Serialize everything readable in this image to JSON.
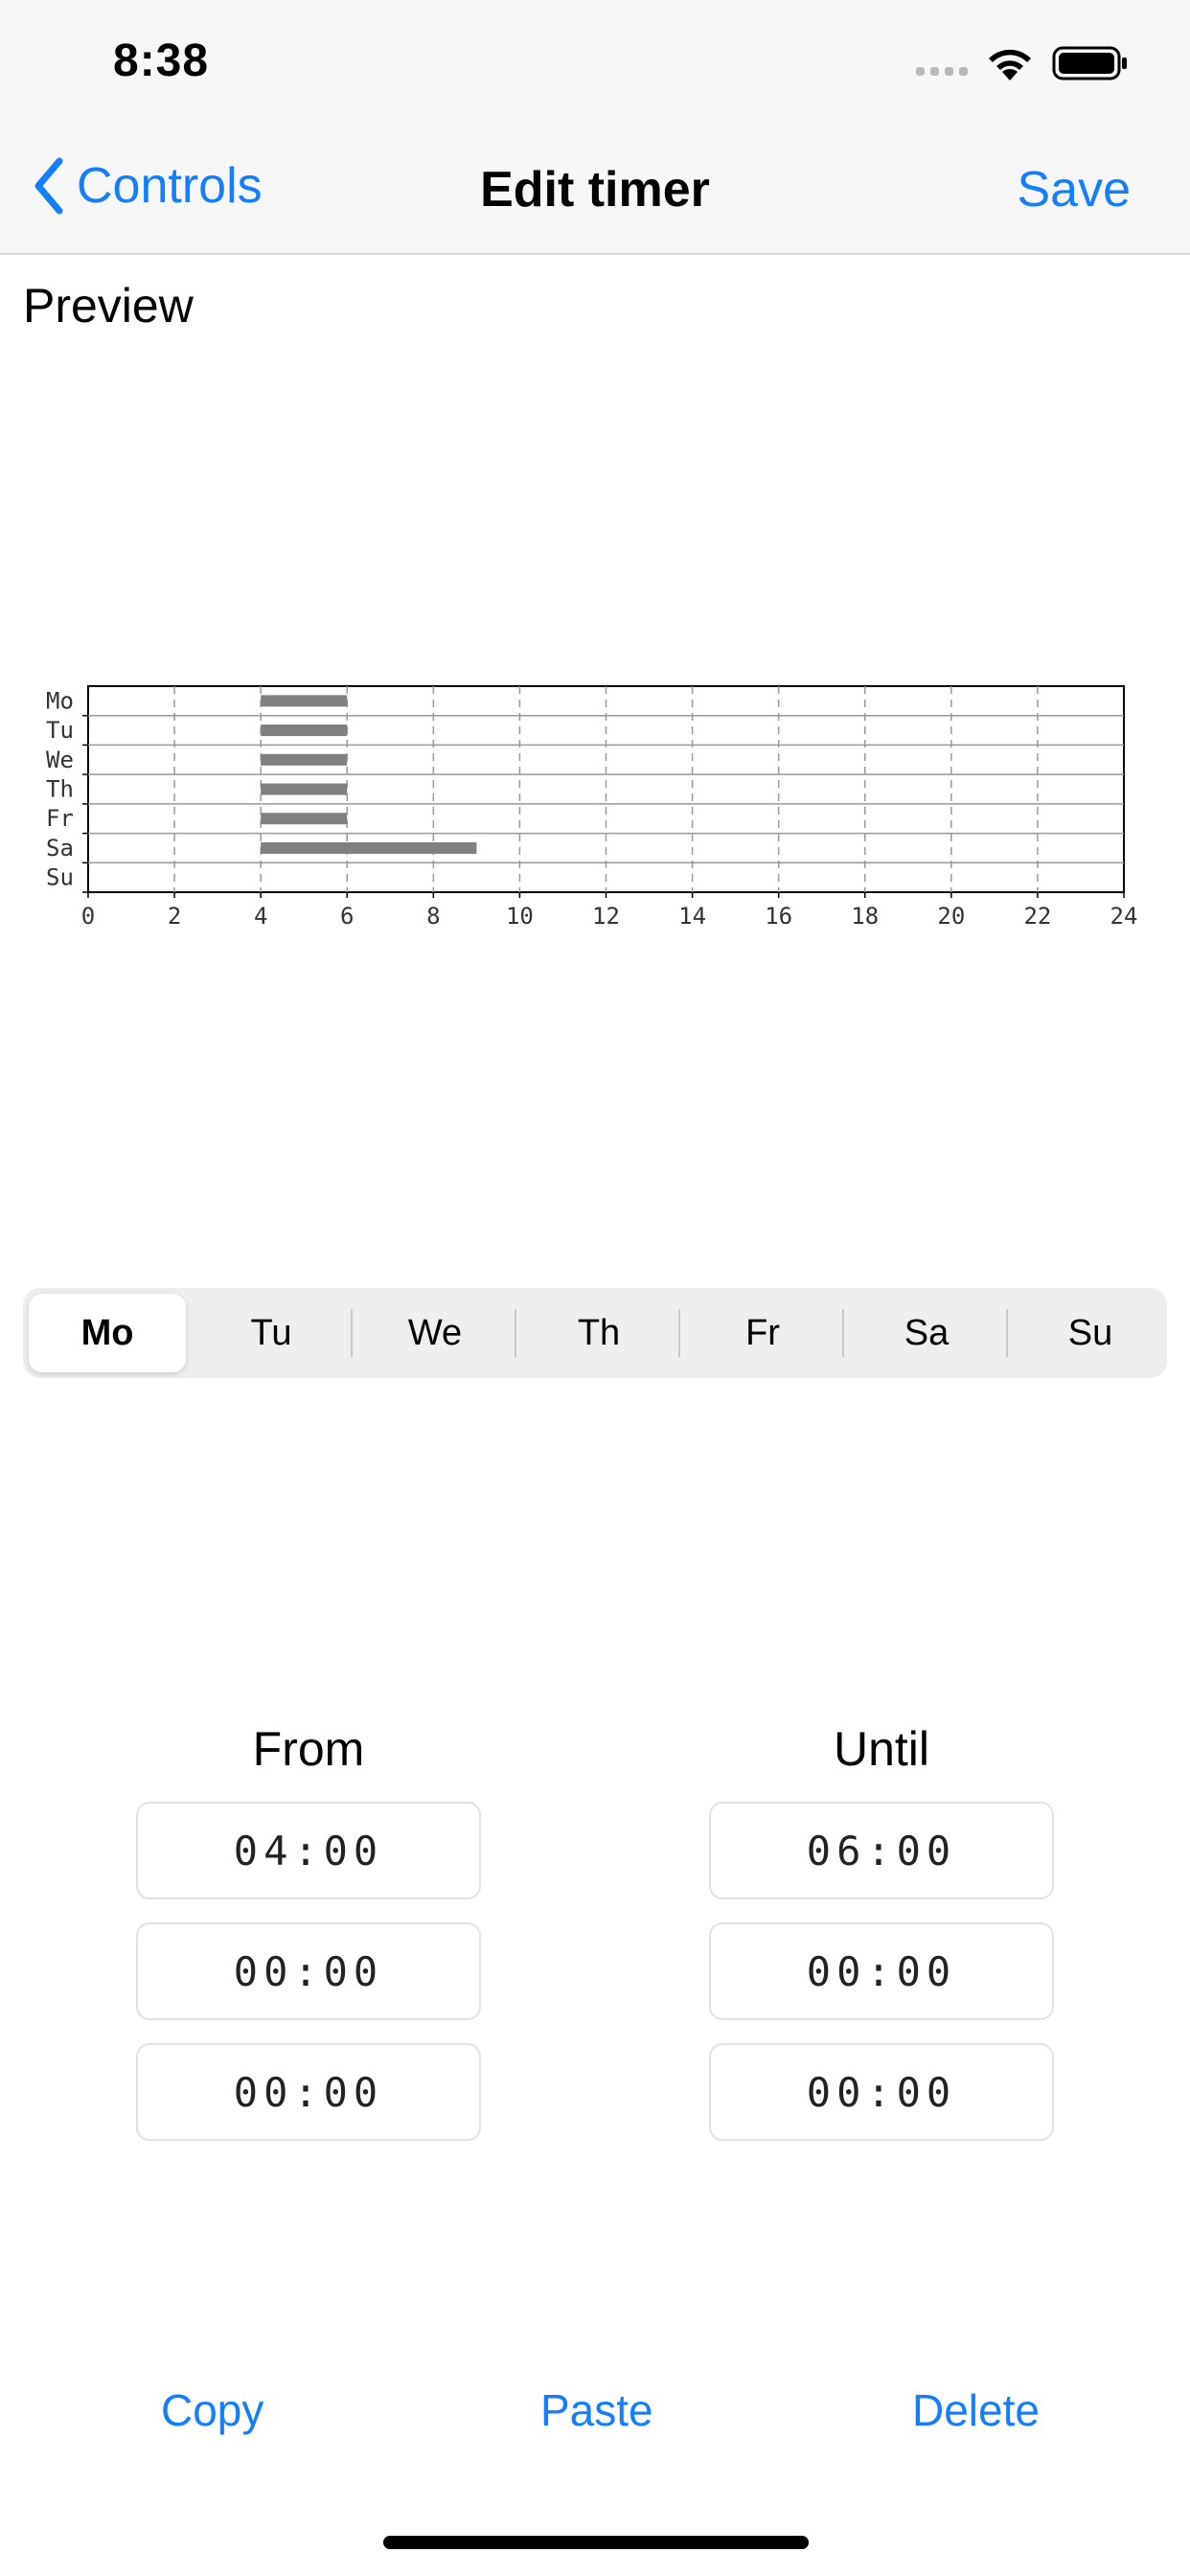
{
  "status": {
    "time": "8:38"
  },
  "nav": {
    "back_label": "Controls",
    "title": "Edit timer",
    "save_label": "Save"
  },
  "preview": {
    "label": "Preview"
  },
  "chart_data": {
    "type": "bar",
    "orientation": "horizontal",
    "categories": [
      "Mo",
      "Tu",
      "We",
      "Th",
      "Fr",
      "Sa",
      "Su"
    ],
    "intervals": [
      {
        "day": "Mo",
        "start": 4,
        "end": 6
      },
      {
        "day": "Tu",
        "start": 4,
        "end": 6
      },
      {
        "day": "We",
        "start": 4,
        "end": 6
      },
      {
        "day": "Th",
        "start": 4,
        "end": 6
      },
      {
        "day": "Fr",
        "start": 4,
        "end": 6
      },
      {
        "day": "Sa",
        "start": 4,
        "end": 9
      }
    ],
    "xlim": [
      0,
      24
    ],
    "xticks": [
      "0",
      "2",
      "4",
      "6",
      "8",
      "10",
      "12",
      "14",
      "16",
      "18",
      "20",
      "22",
      "24"
    ],
    "bar_color": "#808080",
    "grid": true
  },
  "days": [
    {
      "label": "Mo",
      "selected": true
    },
    {
      "label": "Tu",
      "selected": false
    },
    {
      "label": "We",
      "selected": false
    },
    {
      "label": "Th",
      "selected": false
    },
    {
      "label": "Fr",
      "selected": false
    },
    {
      "label": "Sa",
      "selected": false
    },
    {
      "label": "Su",
      "selected": false
    }
  ],
  "from": {
    "label": "From",
    "times": [
      "04:00",
      "00:00",
      "00:00"
    ]
  },
  "until": {
    "label": "Until",
    "times": [
      "06:00",
      "00:00",
      "00:00"
    ]
  },
  "actions": {
    "copy": "Copy",
    "paste": "Paste",
    "delete": "Delete"
  },
  "colors": {
    "accent": "#147efb",
    "bar": "#808080"
  }
}
